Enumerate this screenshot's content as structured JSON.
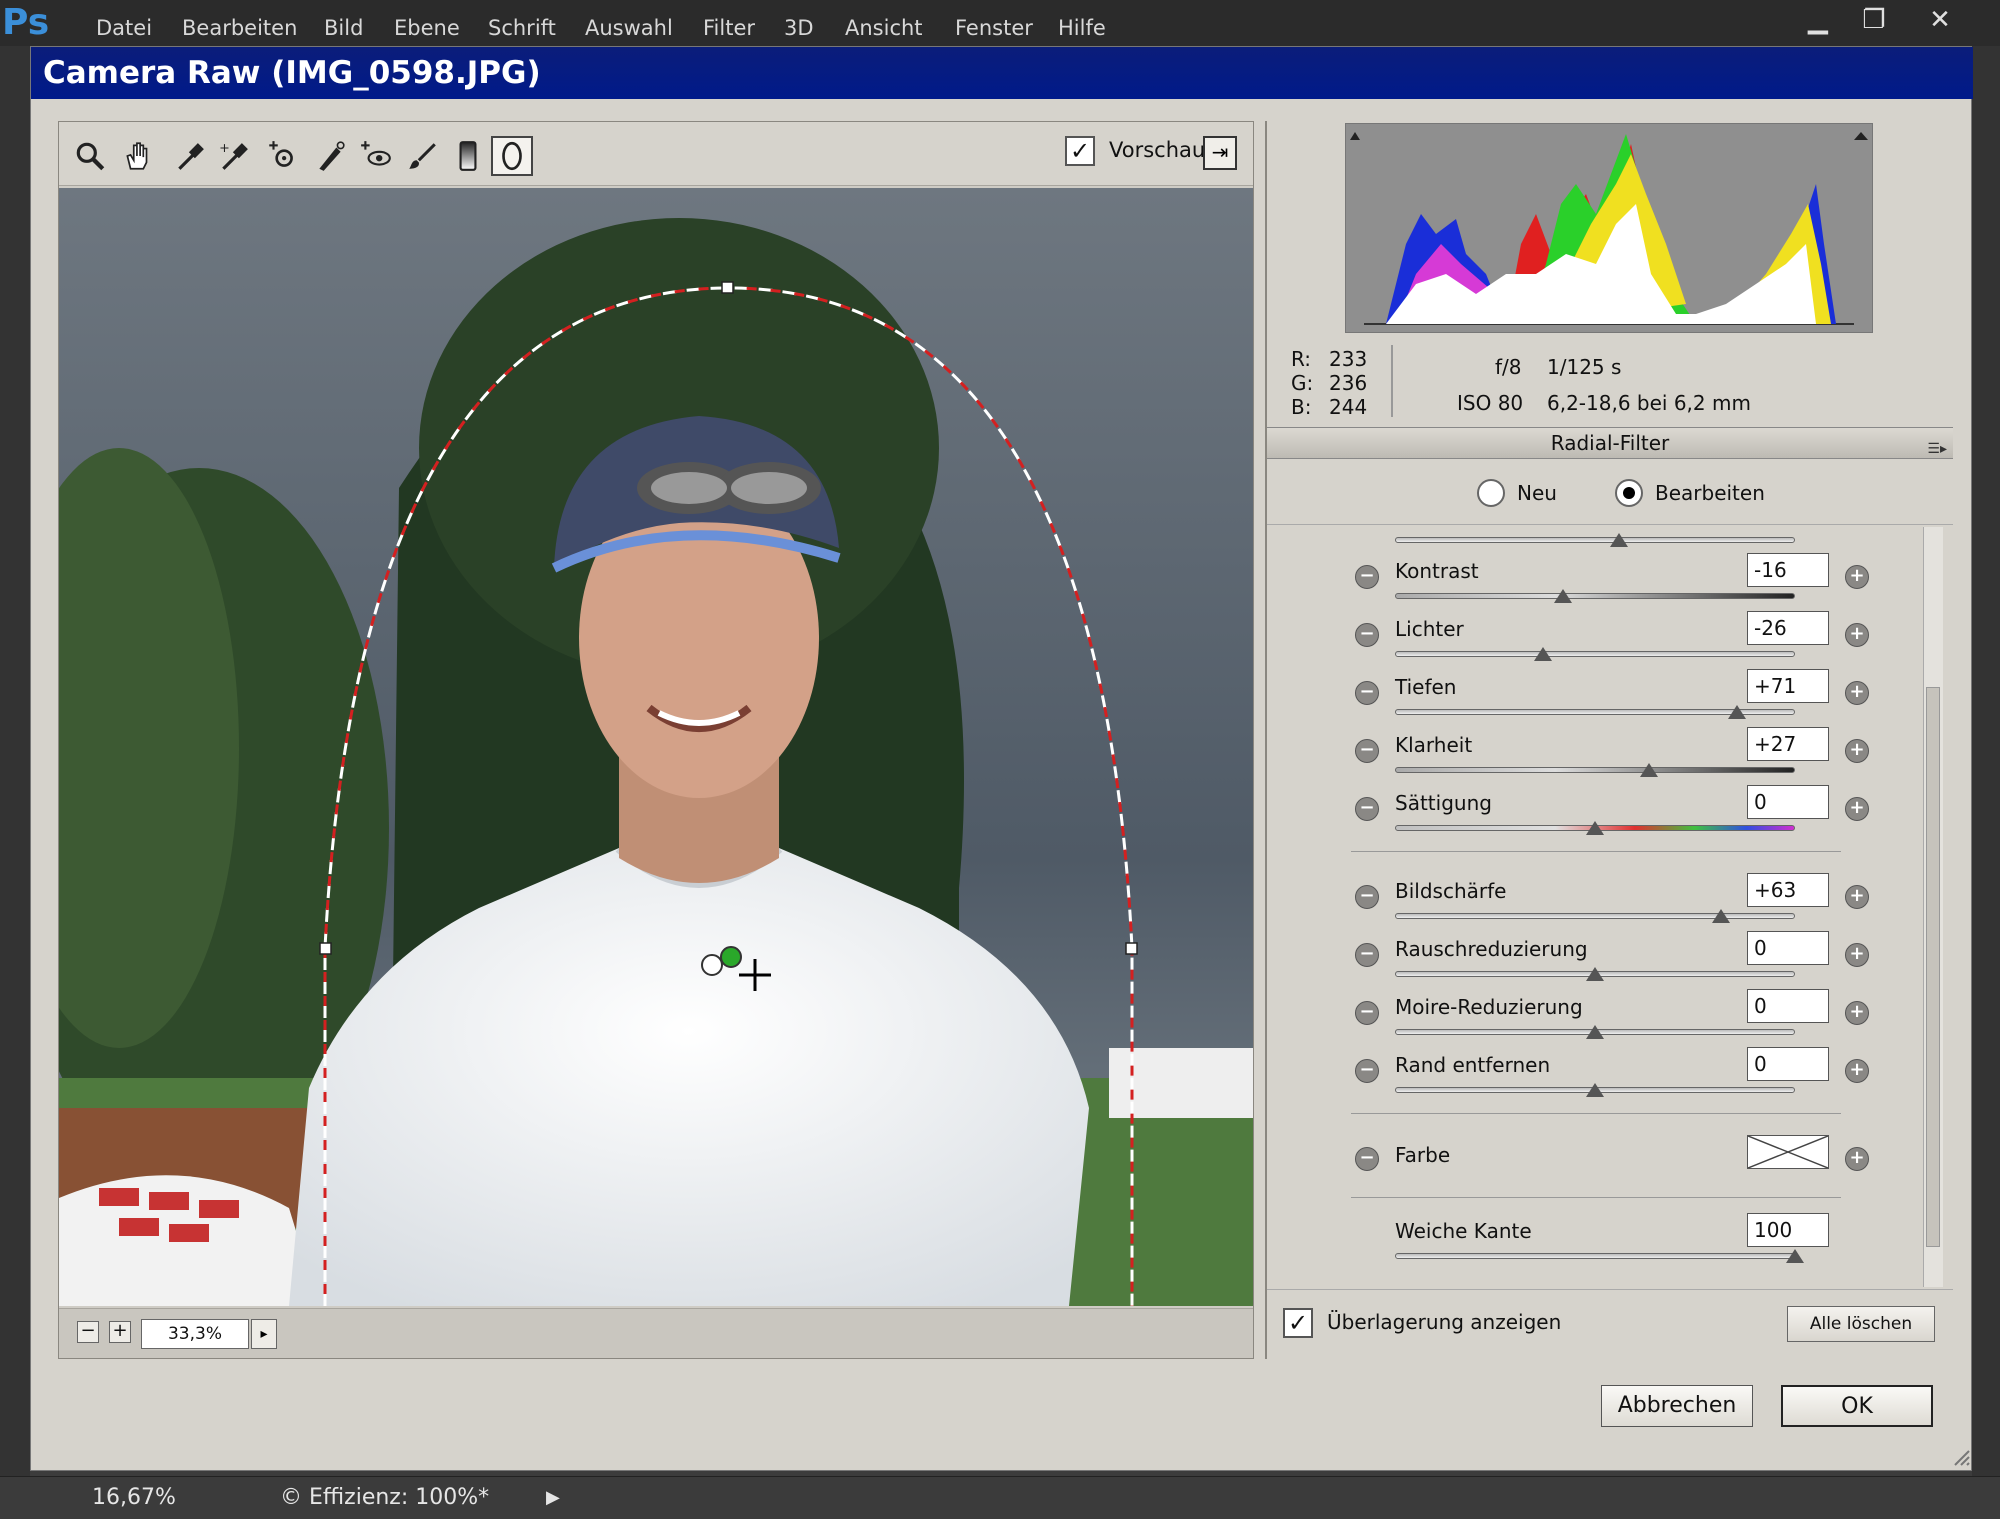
{
  "app": {
    "logo": "Ps",
    "menu": [
      "Datei",
      "Bearbeiten",
      "Bild",
      "Ebene",
      "Schrift",
      "Auswahl",
      "Filter",
      "3D",
      "Ansicht",
      "Fenster",
      "Hilfe"
    ],
    "window_controls": {
      "minimize": "▁",
      "maximize": "❐",
      "close": "✕"
    }
  },
  "dialog": {
    "title": "Camera Raw (IMG_0598.JPG)",
    "toolbar": {
      "tools": [
        "zoom-icon",
        "hand-icon",
        "white-balance-icon",
        "color-sampler-icon",
        "targeted-adjustment-icon",
        "spot-removal-icon",
        "red-eye-icon",
        "adjustment-brush-icon",
        "graduated-filter-icon",
        "radial-filter-icon"
      ],
      "preview_label": "Vorschau",
      "preview_checked": true
    },
    "zoom": {
      "minus": "−",
      "plus": "+",
      "value": "33,3%",
      "arrow": "▸"
    },
    "readout": {
      "r_label": "R:",
      "r": "233",
      "g_label": "G:",
      "g": "236",
      "b_label": "B:",
      "b": "244",
      "aperture": "f/8",
      "shutter": "1/125 s",
      "iso": "ISO 80",
      "lens": "6,2-18,6 bei 6,2 mm"
    },
    "panel": {
      "title": "Radial-Filter",
      "mode_new": "Neu",
      "mode_edit": "Bearbeiten",
      "mode_selected": "Bearbeiten"
    },
    "sliders": [
      {
        "label": "Kontrast",
        "value": "-16",
        "position": 0.42
      },
      {
        "label": "Lichter",
        "value": "-26",
        "position": 0.37
      },
      {
        "label": "Tiefen",
        "value": "+71",
        "position": 0.855
      },
      {
        "label": "Klarheit",
        "value": "+27",
        "position": 0.635
      },
      {
        "label": "Sättigung",
        "value": "0",
        "position": 0.5
      },
      {
        "label": "Bildschärfe",
        "value": "+63",
        "position": 0.815
      },
      {
        "label": "Rauschreduzierung",
        "value": "0",
        "position": 0.5
      },
      {
        "label": "Moire-Reduzierung",
        "value": "0",
        "position": 0.5
      },
      {
        "label": "Rand entfernen",
        "value": "0",
        "position": 0.5
      }
    ],
    "color": {
      "label": "Farbe"
    },
    "feather": {
      "label": "Weiche Kante",
      "value": "100",
      "position": 1.0
    },
    "overlay": {
      "label": "Überlagerung anzeigen",
      "checked": true,
      "clear_label": "Alle löschen"
    },
    "buttons": {
      "cancel": "Abbrechen",
      "ok": "OK"
    }
  },
  "status": {
    "zoom": "16,67%",
    "efficiency": "© Effizienz: 100%*",
    "arrow": "▶"
  }
}
